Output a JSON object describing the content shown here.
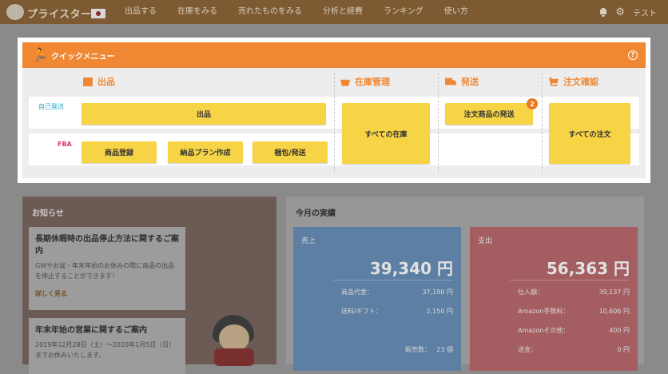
{
  "topnav": {
    "logo_text": "プライスター",
    "items": [
      "出品する",
      "在庫をみる",
      "売れたものをみる",
      "分析と経費",
      "ランキング",
      "使い方"
    ],
    "user": "テスト"
  },
  "quick_menu": {
    "title": "クイックメニュー",
    "sections": {
      "listing": "出品",
      "inventory": "在庫管理",
      "shipping": "発送",
      "orders": "注文確認"
    },
    "row_labels": {
      "self": "自己発送",
      "fba": "FBA"
    },
    "buttons": {
      "list": "出品",
      "product_register": "商品登録",
      "delivery_plan": "納品プラン作成",
      "pack_ship": "梱包/発送",
      "all_inventory": "すべての在庫",
      "ship_orders": "注文商品の発送",
      "all_orders": "すべての注文"
    },
    "ship_badge": "2"
  },
  "news": {
    "title": "お知らせ",
    "items": [
      {
        "title": "長期休暇時の出品停止方法に関するご案内",
        "text": "GWやお盆・年末年始のお休みの際に商品の出品を停止することができます！",
        "link": "詳しく見る"
      },
      {
        "title": "年末年始の営業に関するご案内",
        "text": "2019年12月28日（土）～2020年1月5日（日）までお休みいたします。"
      }
    ]
  },
  "performance": {
    "title": "今月の実績",
    "sales": {
      "label": "売上",
      "total": "39,340 円",
      "rows": [
        {
          "k": "商品代金：",
          "v": "37,190 円"
        },
        {
          "k": "送料/ギフト：",
          "v": "2,150 円"
        },
        {
          "k": "販売数：",
          "v": "23 個"
        }
      ]
    },
    "cost": {
      "label": "支出",
      "total": "56,363 円",
      "rows": [
        {
          "k": "仕入額：",
          "v": "39,137 円"
        },
        {
          "k": "Amazon手数料：",
          "v": "10,606 円"
        },
        {
          "k": "Amazonその他：",
          "v": "400 円"
        },
        {
          "k": "送金：",
          "v": "0 円"
        }
      ]
    }
  },
  "colors": {
    "accent": "#ef8733",
    "button": "#f7d346",
    "self_label": "#2aa8c4",
    "fba_label": "#e3356a"
  }
}
